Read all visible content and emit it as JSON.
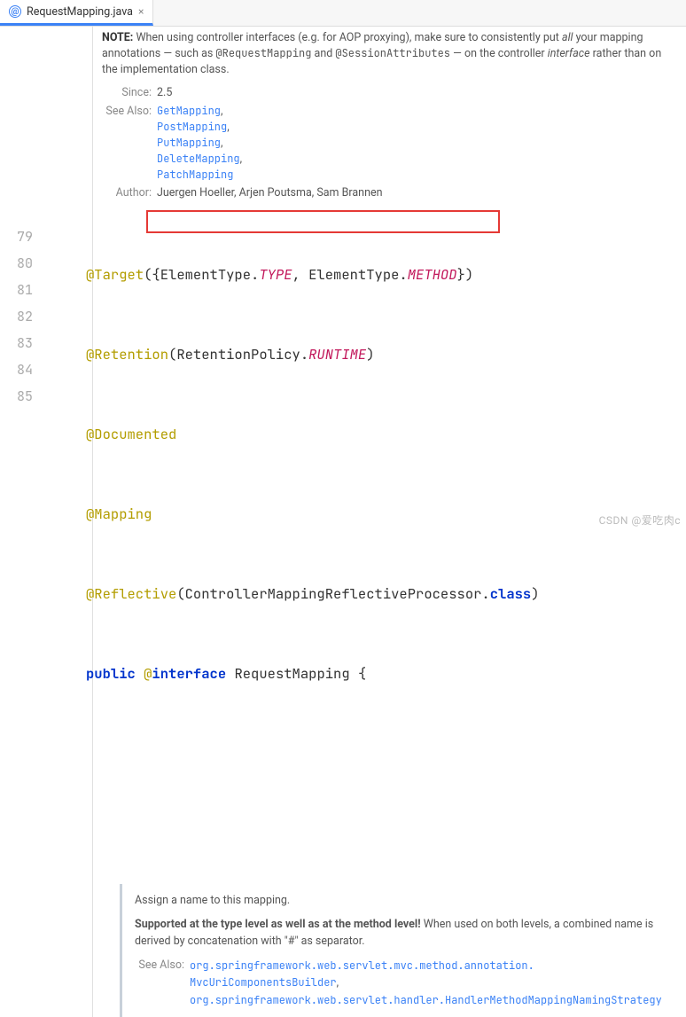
{
  "tab": {
    "filename": "RequestMapping.java"
  },
  "javadoc": {
    "note_prefix": "NOTE:",
    "note_body_1": " When using controller interfaces (e.g. for AOP proxying), make sure to consistently put ",
    "note_em": "all",
    "note_body_2": " your mapping annotations — such as ",
    "mono1": "@RequestMapping",
    "and": " and ",
    "mono2": "@SessionAttributes",
    "note_body_3": " — on the controller ",
    "iface": "interface",
    "note_body_4": " rather than on the implementation class.",
    "since_label": "Since:",
    "since_value": "2.5",
    "seealso_label": "See Also:",
    "seealso": [
      "GetMapping",
      "PostMapping",
      "PutMapping",
      "DeleteMapping",
      "PatchMapping"
    ],
    "author_label": "Author:",
    "author_value": "Juergen Hoeller, Arjen Poutsma, Sam Brannen"
  },
  "gutter": [
    "79",
    "80",
    "81",
    "82",
    "83",
    "84",
    "85"
  ],
  "code": {
    "l79": {
      "at": "@Target",
      "open": "({",
      "t1": "ElementType.",
      "c1": "TYPE",
      "mid": ", ElementType.",
      "c2": "METHOD",
      "close": "})"
    },
    "l80": {
      "at": "@Retention",
      "open": "(RetentionPolicy.",
      "c": "RUNTIME",
      "close": ")"
    },
    "l81": {
      "at": "@Documented"
    },
    "l82": {
      "at": "@Mapping"
    },
    "l83": {
      "at": "@Reflective",
      "open": "(ControllerMappingReflectiveProcessor.",
      "kw": "class",
      "close": ")"
    },
    "l84": {
      "kw1": "public ",
      "at": "@",
      "kw2": "interface ",
      "name": "RequestMapping",
      "brace": " {"
    }
  },
  "doc2": {
    "p1": "Assign a name to this mapping.",
    "strong": "Supported at the type level as well as at the method level!",
    "p2": " When used on both levels, a combined name is derived by concatenation with \"#\" as separator.",
    "see_label": "See Also:",
    "see1a": "org.springframework.web.servlet.mvc.method.annotation.",
    "see1b": "MvcUriComponentsBuilder",
    "see2": "org.springframework.web.servlet.handler.HandlerMethodMappingNamingStrategy"
  },
  "watermark": "CSDN @爱吃肉c"
}
